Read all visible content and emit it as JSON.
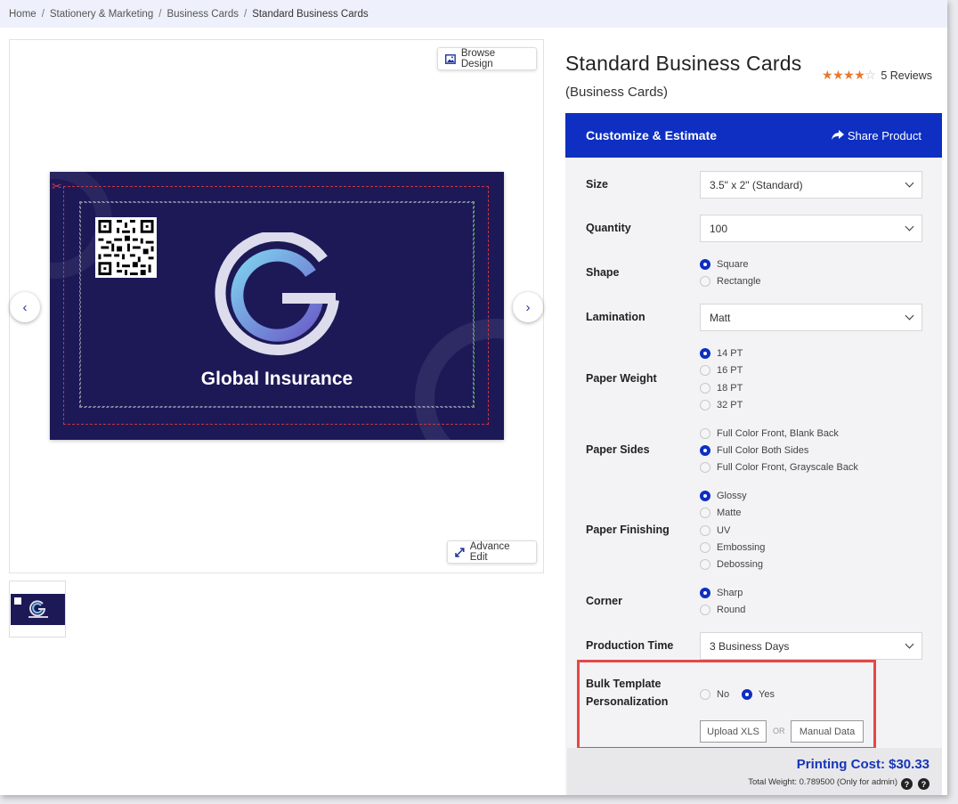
{
  "breadcrumb": {
    "items": [
      "Home",
      "Stationery & Marketing",
      "Business Cards",
      "Standard Business Cards"
    ],
    "separator": "/"
  },
  "preview": {
    "browse_label": "Browse Design",
    "advance_label": "Advance Edit",
    "card_text": "Global Insurance",
    "card_color": "#1d1957"
  },
  "product": {
    "title": "Standard Business Cards",
    "subtitle": "(Business Cards)",
    "rating": 4,
    "rating_max": 5,
    "reviews_label": "5 Reviews"
  },
  "panel": {
    "header": "Customize & Estimate",
    "share_label": "Share Product",
    "accent": "#0e2fc2"
  },
  "options": {
    "size": {
      "label": "Size",
      "value": "3.5\" x 2\" (Standard)"
    },
    "quantity": {
      "label": "Quantity",
      "value": "100"
    },
    "shape": {
      "label": "Shape",
      "choices": [
        "Square",
        "Rectangle"
      ],
      "selected": 0
    },
    "lamination": {
      "label": "Lamination",
      "value": "Matt"
    },
    "paper_weight": {
      "label": "Paper Weight",
      "choices": [
        "14 PT",
        "16 PT",
        "18 PT",
        "32 PT"
      ],
      "selected": 0
    },
    "paper_sides": {
      "label": "Paper Sides",
      "choices": [
        "Full Color Front, Blank Back",
        "Full Color Both Sides",
        "Full Color Front, Grayscale Back"
      ],
      "selected": 1
    },
    "paper_finishing": {
      "label": "Paper Finishing",
      "choices": [
        "Glossy",
        "Matte",
        "UV",
        "Embossing",
        "Debossing"
      ],
      "selected": 0
    },
    "corner": {
      "label": "Corner",
      "choices": [
        "Sharp",
        "Round"
      ],
      "selected": 0
    },
    "production_time": {
      "label": "Production Time",
      "value": "3 Business Days"
    },
    "bulk": {
      "label_line1": "Bulk Template",
      "label_line2": "Personalization",
      "choices": [
        "No",
        "Yes"
      ],
      "selected": 1,
      "upload_label": "Upload XLS",
      "or_label": "OR",
      "manual_label": "Manual Data"
    }
  },
  "pricing": {
    "cost_label": "Printing Cost: $30.33",
    "weight_label": "Total Weight: 0.789500 (Only for admin)",
    "help_icon": "?"
  }
}
